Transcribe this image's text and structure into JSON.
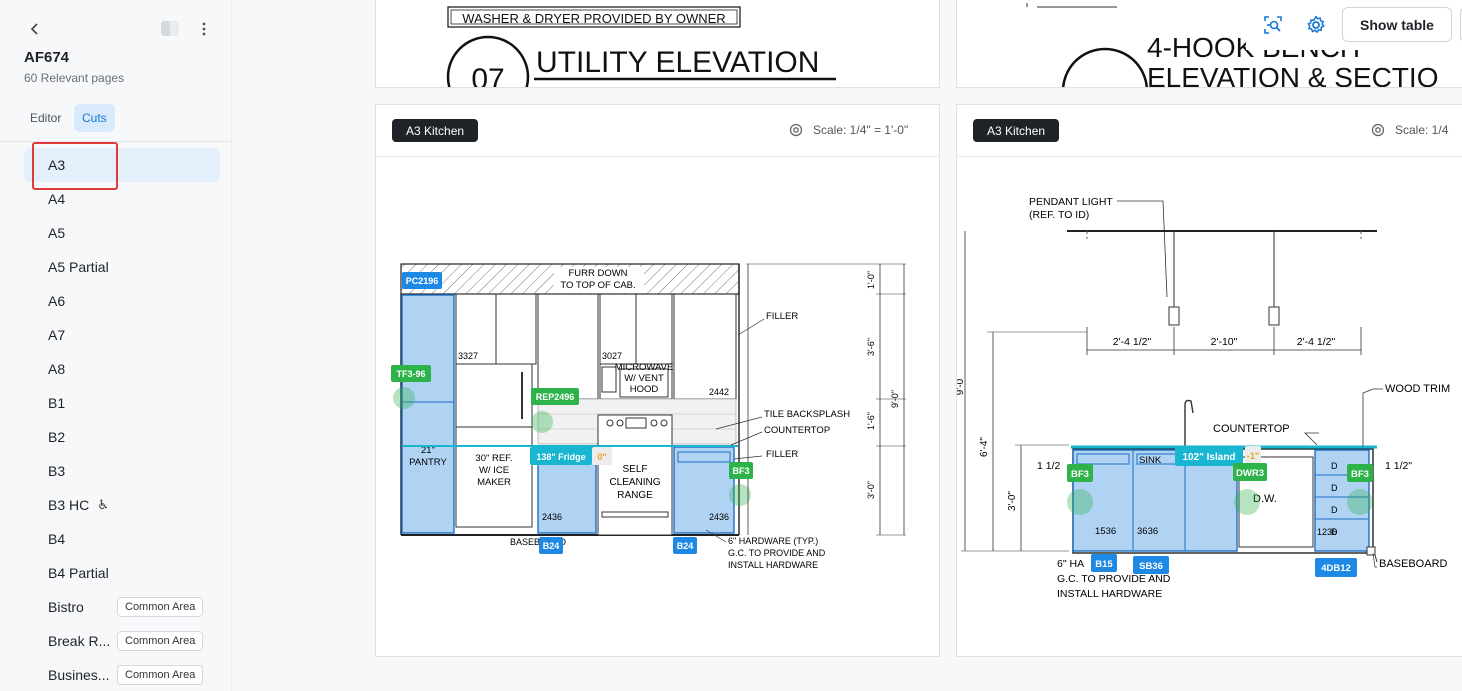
{
  "sidebar": {
    "title": "AF674",
    "subtitle": "60 Relevant pages",
    "tabs": [
      {
        "label": "Editor"
      },
      {
        "label": "Cuts"
      }
    ],
    "items": [
      {
        "label": "A3"
      },
      {
        "label": "A4"
      },
      {
        "label": "A5"
      },
      {
        "label": "A5 Partial"
      },
      {
        "label": "A6"
      },
      {
        "label": "A7"
      },
      {
        "label": "A8"
      },
      {
        "label": "B1"
      },
      {
        "label": "B2"
      },
      {
        "label": "B3"
      },
      {
        "label": "B3 HC"
      },
      {
        "label": "B4"
      },
      {
        "label": "B4 Partial"
      },
      {
        "label": "Bistro",
        "badge": "Common Area"
      },
      {
        "label": "Break R...",
        "badge": "Common Area"
      },
      {
        "label": "Busines...",
        "badge": "Common Area"
      }
    ]
  },
  "toolbar": {
    "show_table_label": "Show table"
  },
  "top_cards": {
    "left": {
      "note": "WASHER & DRYER PROVIDED BY OWNER",
      "number": "07",
      "title": "UTILITY ELEVATION"
    },
    "right": {
      "title_line1": "4-HOOK BENCH",
      "title_line2": "ELEVATION & SECTIO"
    }
  },
  "cards": [
    {
      "tag": "A3 Kitchen",
      "scale": "Scale: 1/4\" = 1'-0\"",
      "drawing": {
        "furr": [
          "FURR DOWN",
          "TO TOP OF CAB."
        ],
        "dims": [
          "1'-0\"",
          "3'-6\"",
          "9'-0\"",
          "1'-6\"",
          "3'-0\""
        ],
        "notes": [
          "FILLER",
          "TILE BACKSPLASH",
          "COUNTERTOP",
          "FILLER",
          "6\" HARDWARE (TYP.)",
          "G.C. TO PROVIDE AND",
          "INSTALL HARDWARE",
          "BASEBOARD"
        ],
        "texts": [
          "3327",
          "3027",
          "2442",
          "2436",
          "2436",
          "MICROWAVE",
          "W/ VENT",
          "HOOD",
          "21\"",
          "PANTRY",
          "30\" REF.",
          "W/ ICE",
          "MAKER",
          "SELF",
          "CLEANING",
          "RANGE"
        ],
        "tags": [
          "PC2196",
          "TF3-96",
          "REP2496",
          "138\" Fridge",
          "0\"",
          "BF3",
          "B24",
          "B24"
        ]
      }
    },
    {
      "tag": "A3 Kitchen",
      "scale": "Scale: 1/4",
      "drawing": {
        "notes": [
          "PENDANT LIGHT",
          "(REF. TO ID)",
          "WOOD TRIM",
          "COUNTERTOP",
          "D.W.",
          "BASEBOARD",
          "6\" HA",
          "G.C. TO PROVIDE AND",
          "INSTALL HARDWARE"
        ],
        "dims": [
          "2'-4 1/2\"",
          "2'-10\"",
          "2'-4 1/2\"",
          "6'-4\"",
          "3'-0\"",
          "1 1/2",
          "1 1/2\"",
          "9'-0"
        ],
        "texts": [
          "SINK",
          "1536",
          "3636",
          "1236",
          "D",
          "D",
          "D",
          "D"
        ],
        "tags": [
          "BF3",
          "102\" Island",
          "-1\"",
          "DWR3",
          "BF3",
          "B15",
          "SB36",
          "4DB12"
        ]
      }
    }
  ],
  "colors": {
    "accent": "#1677d2",
    "tag_blue": "#1e88e5",
    "tag_green": "#2db34a",
    "tag_cyan": "#19b6d2",
    "highlight_red": "#e03a3a"
  }
}
